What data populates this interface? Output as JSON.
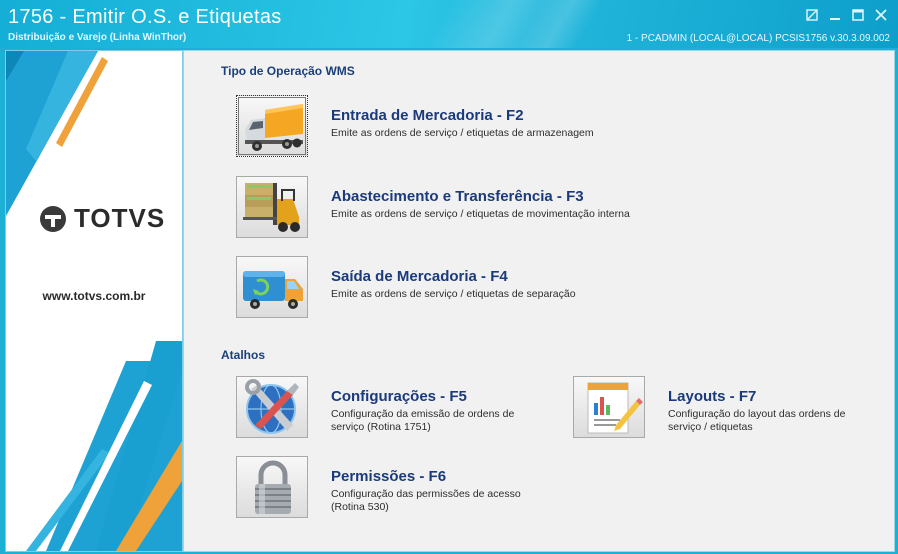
{
  "window": {
    "title": "1756 - Emitir O.S. e Etiquetas",
    "subtitle": "Distribuição e Varejo (Linha WinThor)",
    "status": "1 - PCADMIN (LOCAL@LOCAL)   PCSIS1756  v.30.3.09.002"
  },
  "brand": {
    "logo_text": "TOTVS",
    "site": "www.totvs.com.br"
  },
  "sections": {
    "wms_title": "Tipo de Operação WMS",
    "shortcuts_title": "Atalhos"
  },
  "operations": {
    "entrada": {
      "label": "Entrada de Mercadoria - F2",
      "desc": "Emite as ordens de serviço / etiquetas de armazenagem"
    },
    "abastecimento": {
      "label": "Abastecimento e Transferência - F3",
      "desc": "Emite as ordens de serviço / etiquetas de movimentação interna"
    },
    "saida": {
      "label": "Saída de Mercadoria - F4",
      "desc": "Emite as ordens de serviço / etiquetas de separação"
    }
  },
  "shortcuts": {
    "config": {
      "label": "Configurações - F5",
      "desc": "Configuração da emissão de ordens de serviço (Rotina 1751)"
    },
    "layouts": {
      "label": "Layouts - F7",
      "desc": "Configuração do layout das ordens de serviço / etiquetas"
    },
    "permissoes": {
      "label": "Permissões - F6",
      "desc": "Configuração das permissões de acesso (Rotina 530)"
    }
  },
  "colors": {
    "titlebar": "#1cb0d4",
    "heading": "#1a3a7c",
    "accent_blue": "#1ea2d3",
    "accent_orange": "#f0a23a"
  }
}
